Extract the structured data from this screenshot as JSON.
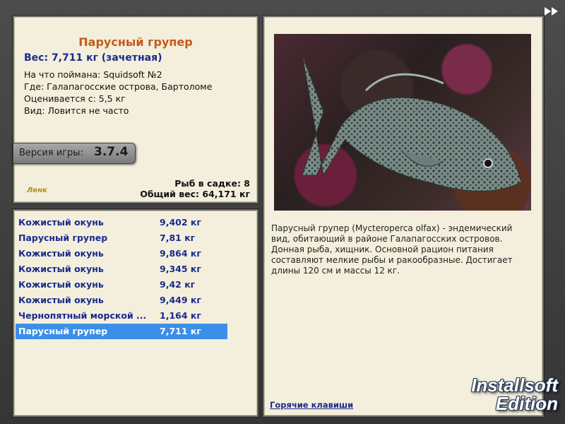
{
  "fish": {
    "title": "Парусный групер",
    "weight": "Вес: 7,711 кг (зачетная)",
    "caught_with": "На что поймана: Squidsoft №2",
    "location": "Где: Галапагосские острова, Бартоломе",
    "rated_from": "Оценивается с: 5,5 кг",
    "kind": "Вид: Ловится не часто"
  },
  "version": {
    "label": "Версия игры:",
    "value": "3.7.4"
  },
  "small_logo": "Ленк",
  "stats": {
    "fish_in_net": "Рыб в садке: 8",
    "total_weight": "Общий вес: 64,171 кг"
  },
  "catch_list": [
    {
      "name": "Кожистый окунь",
      "weight": "9,402 кг"
    },
    {
      "name": "Парусный групер",
      "weight": "7,81 кг"
    },
    {
      "name": "Кожистый окунь",
      "weight": "9,864 кг"
    },
    {
      "name": "Кожистый окунь",
      "weight": "9,345 кг"
    },
    {
      "name": "Кожистый окунь",
      "weight": "9,42 кг"
    },
    {
      "name": "Кожистый окунь",
      "weight": "9,449 кг"
    },
    {
      "name": "Чернопятный морской ...",
      "weight": "1,164 кг"
    },
    {
      "name": "Парусный групер",
      "weight": "7,711 кг"
    }
  ],
  "selected_index": 7,
  "description": "Парусный групер (Mycteroperca olfax) - эндемический вид, обитающий в районе Галапагосских островов. Донная рыба, хищник. Основной рацион питания составляют мелкие рыбы и ракообразные. Достигает длины 120 см и массы 12 кг.",
  "hotkeys_link": "Горячие клавиши",
  "brand": {
    "line1": "Installsoft",
    "line2": "Edition"
  },
  "colors": {
    "title": "#c65a18",
    "link": "#1a2a8c",
    "selection": "#3b8fe8",
    "panel": "#f3efdc"
  }
}
